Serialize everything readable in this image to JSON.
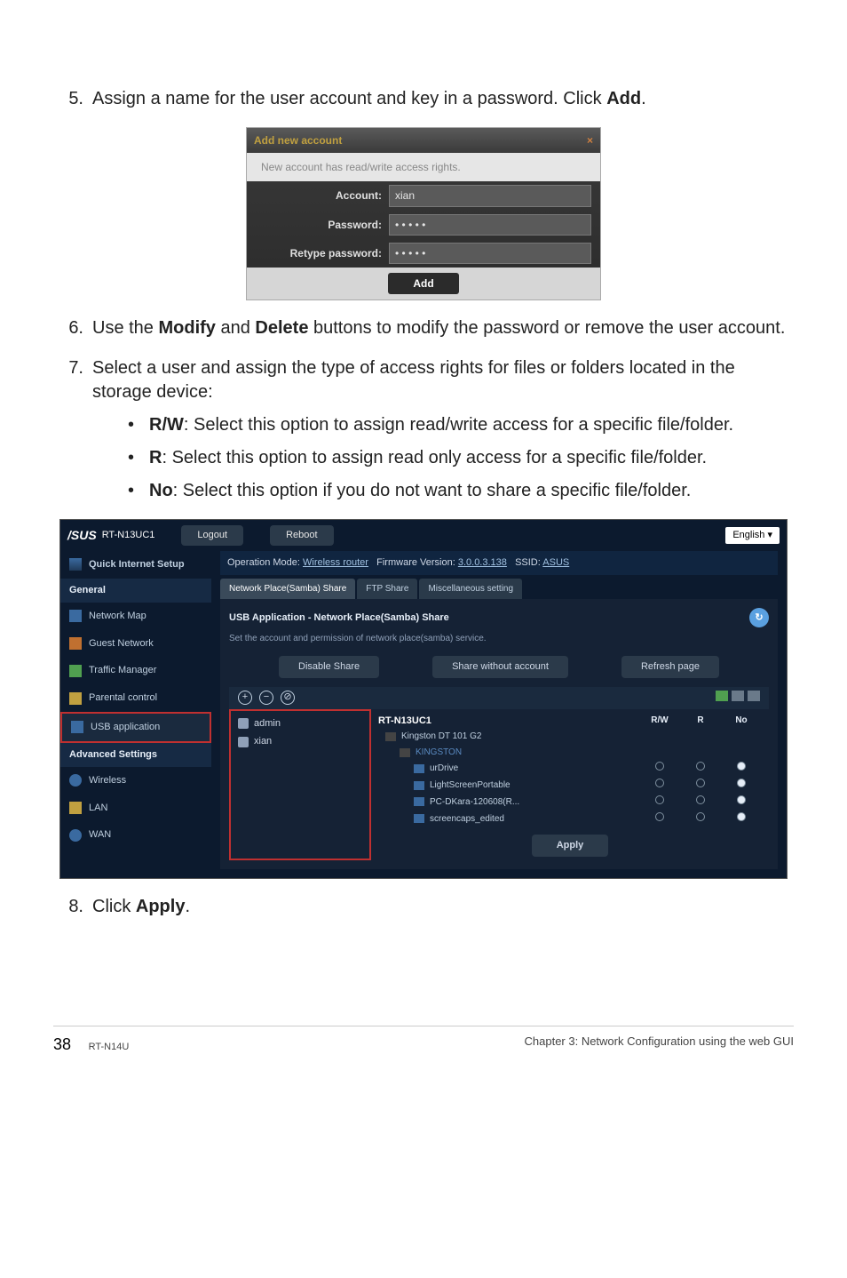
{
  "steps": {
    "s5": {
      "num": "5.",
      "text_a": "Assign a name for the user account and key in a password. Click ",
      "bold": "Add",
      "text_b": "."
    },
    "s6": {
      "num": "6.",
      "text_a": "Use the ",
      "b1": "Modify",
      "mid": " and ",
      "b2": "Delete",
      "text_b": " buttons to modify the password or remove the user account."
    },
    "s7": {
      "num": "7.",
      "text": "Select a user and assign the type of access rights for files or folders located in the storage device:"
    },
    "s8": {
      "num": "8.",
      "text_a": "Click ",
      "bold": "Apply",
      "text_b": "."
    }
  },
  "bullets": {
    "rw": {
      "b": "R/W",
      "t": ": Select this option to assign read/write access for a specific file/folder."
    },
    "r": {
      "b": "R",
      "t": ": Select this option to assign read only access for a specific file/folder."
    },
    "no": {
      "b": "No",
      "t": ": Select this option if you do not want to share a specific file/folder."
    }
  },
  "modal": {
    "title": "Add new account",
    "close": "×",
    "msg": "New account has read/write access rights.",
    "account_label": "Account:",
    "account_value": "xian",
    "password_label": "Password:",
    "password_value": "• • • • •",
    "retype_label": "Retype password:",
    "retype_value": "• • • • •",
    "add_btn": "Add"
  },
  "router": {
    "brand": "/SUS",
    "model": "RT-N13UC1",
    "logout": "Logout",
    "reboot": "Reboot",
    "lang": "English",
    "opmode_label": "Operation Mode:",
    "opmode_value": "Wireless router",
    "fw_label": "Firmware Version:",
    "fw_value": "3.0.0.3.138",
    "ssid_label": "SSID:",
    "ssid_value": "ASUS",
    "tabs": [
      "Network Place(Samba) Share",
      "FTP Share",
      "Miscellaneous setting"
    ],
    "panel_title": "USB Application - Network Place(Samba) Share",
    "panel_sub": "Set the account and permission of network place(samba) service.",
    "btns": {
      "disable": "Disable Share",
      "nowo": "Share without account",
      "refresh": "Refresh page"
    },
    "circle": {
      "plus": "+",
      "minus": "−",
      "no": "⊘"
    },
    "users": [
      "admin",
      "xian"
    ],
    "device": "RT-N13UC1",
    "drive": "Kingston DT 101 G2",
    "vol": "KINGSTON",
    "rights": {
      "rw": "R/W",
      "r": "R",
      "no": "No"
    },
    "folders": [
      "urDrive",
      "LightScreenPortable",
      "PC-DKara-120608(R...",
      "screencaps_edited"
    ],
    "apply": "Apply",
    "side_quick": "Quick Internet Setup",
    "side_general": "General",
    "side_items": [
      "Network Map",
      "Guest Network",
      "Traffic Manager",
      "Parental control",
      "USB application"
    ],
    "side_adv": "Advanced Settings",
    "side_adv_items": [
      "Wireless",
      "LAN",
      "WAN"
    ]
  },
  "footer": {
    "page": "38",
    "model": "RT-N14U",
    "chapter": "Chapter 3: Network Configuration using the web GUI"
  }
}
